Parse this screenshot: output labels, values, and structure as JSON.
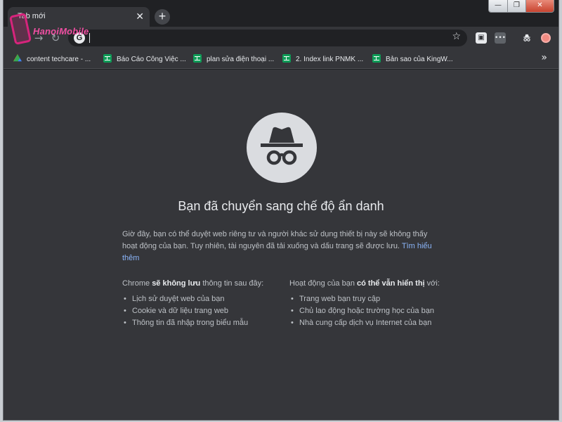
{
  "tab": {
    "title": "Tab mới"
  },
  "logo": {
    "text": "HanoiMobile"
  },
  "bookmarks": [
    {
      "label": "content techcare - ...",
      "icon": "drive-icon"
    },
    {
      "label": "Báo Cáo Công Việc ...",
      "icon": "sheets-icon"
    },
    {
      "label": "plan sửa điện thoại ...",
      "icon": "sheets-icon"
    },
    {
      "label": "2. Index link PNMK ...",
      "icon": "sheets-icon"
    },
    {
      "label": "Bản sao của KingW...",
      "icon": "sheets-icon"
    }
  ],
  "incognito": {
    "headline": "Bạn đã chuyển sang chế độ ẩn danh",
    "paragraph": "Giờ đây, bạn có thể duyệt web riêng tư và người khác sử dụng thiết bị này sẽ không thấy hoạt động của bạn. Tuy nhiên, tài nguyên đã tải xuống và dấu trang sẽ được lưu.",
    "learn_more": "Tìm hiểu thêm",
    "left": {
      "intro_pre": "Chrome",
      "intro_bold": "sẽ không lưu",
      "intro_post": "thông tin sau đây:",
      "items": [
        "Lịch sử duyệt web của bạn",
        "Cookie và dữ liệu trang web",
        "Thông tin đã nhập trong biểu mẫu"
      ]
    },
    "right": {
      "intro_pre": "Hoạt động của bạn",
      "intro_bold": "có thể vẫn hiển thị",
      "intro_post": "với:",
      "items": [
        "Trang web bạn truy cập",
        "Chủ lao động hoặc trường học của bạn",
        "Nhà cung cấp dịch vụ Internet của bạn"
      ]
    }
  },
  "colors": {
    "background": "#35363a",
    "frame": "#202124",
    "text": "#e8eaed",
    "link": "#8ab4f8"
  }
}
